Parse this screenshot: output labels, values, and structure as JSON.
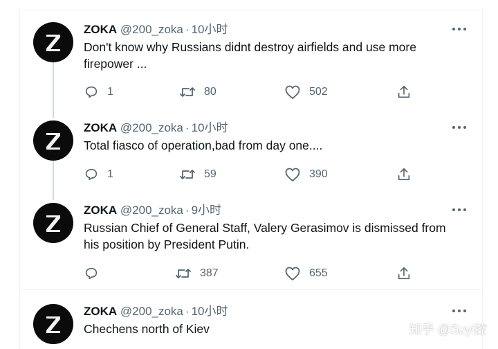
{
  "tweets": [
    {
      "name": "ZOKA",
      "handle": "@200_zoka",
      "separator": "·",
      "time": "10小时",
      "text": "Don't know why Russians didnt destroy airfields and use more firepower ...",
      "replies": "1",
      "retweets": "80",
      "likes": "502",
      "icons": {
        "reply": "reply-icon",
        "retweet": "retweet-icon",
        "like": "heart-icon",
        "share": "share-icon",
        "more": "more-icon"
      }
    },
    {
      "name": "ZOKA",
      "handle": "@200_zoka",
      "separator": "·",
      "time": "10小时",
      "text": "Total fiasco of operation,bad from day one....",
      "replies": "1",
      "retweets": "59",
      "likes": "390"
    },
    {
      "name": "ZOKA",
      "handle": "@200_zoka",
      "separator": "·",
      "time": "9小时",
      "text": "Russian Chief of General Staff, Valery Gerasimov is dismissed from his position by President Putin.",
      "replies": "",
      "retweets": "387",
      "likes": "655"
    },
    {
      "name": "ZOKA",
      "handle": "@200_zoka",
      "separator": "·",
      "time": "10小时",
      "text": "Chechens north of Kiev"
    }
  ],
  "watermark": "知乎 @Suyi控",
  "colors": {
    "text": "#0f1419",
    "secondary": "#536471",
    "thread_line": "#cfd9de",
    "avatar_bg": "#0b0b0b"
  }
}
